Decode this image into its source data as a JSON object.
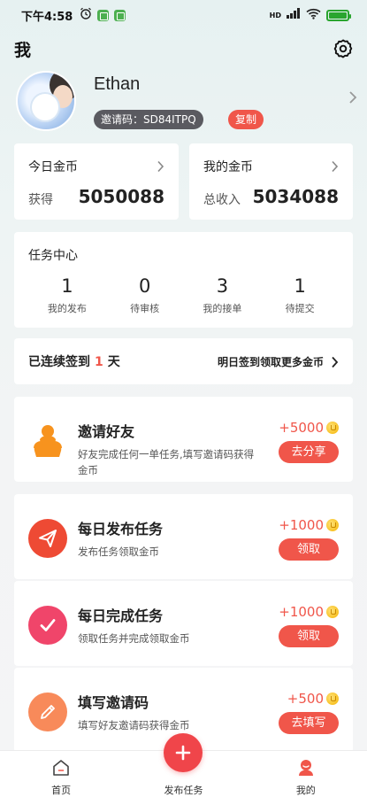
{
  "status_bar": {
    "time": "下午4:58",
    "network": "HD",
    "battery_color": "#2aa52f"
  },
  "header": {
    "title": "我"
  },
  "profile": {
    "name": "Ethan",
    "invite_label": "邀请码：SD84ITPQ",
    "copy_label": "复制"
  },
  "coins": {
    "today": {
      "title": "今日金币",
      "sub": "获得",
      "value": "5050088"
    },
    "mine": {
      "title": "我的金币",
      "sub": "总收入",
      "value": "5034088"
    }
  },
  "task_center": {
    "title": "任务中心",
    "stats": [
      {
        "value": "1",
        "label": "我的发布"
      },
      {
        "value": "0",
        "label": "待审核"
      },
      {
        "value": "3",
        "label": "我的接单"
      },
      {
        "value": "1",
        "label": "待提交"
      }
    ]
  },
  "signin": {
    "prefix": "已连续签到",
    "days": "1",
    "suffix": "天",
    "right_text": "明日签到领取更多金币"
  },
  "tasks": [
    {
      "title": "邀请好友",
      "desc": "好友完成任何一单任务,填写邀请码获得金币",
      "reward": "+5000",
      "button": "去分享",
      "icon": "users-icon",
      "color": "#f7931e"
    },
    {
      "title": "每日发布任务",
      "desc": "发布任务领取金币",
      "reward": "+1000",
      "button": "领取",
      "icon": "paper-plane-icon",
      "color": "#ee4a34"
    },
    {
      "title": "每日完成任务",
      "desc": "领取任务并完成领取金币",
      "reward": "+1000",
      "button": "领取",
      "icon": "checkmark-icon",
      "color": "#f0456a"
    },
    {
      "title": "填写邀请码",
      "desc": "填写好友邀请码获得金币",
      "reward": "+500",
      "button": "去填写",
      "icon": "pencil-icon",
      "color": "#f88a5a"
    }
  ],
  "tabbar": {
    "home": "首页",
    "publish": "发布任务",
    "mine": "我的"
  },
  "colors": {
    "accent": "#f0564a",
    "chip_dark": "#5a5a60"
  }
}
